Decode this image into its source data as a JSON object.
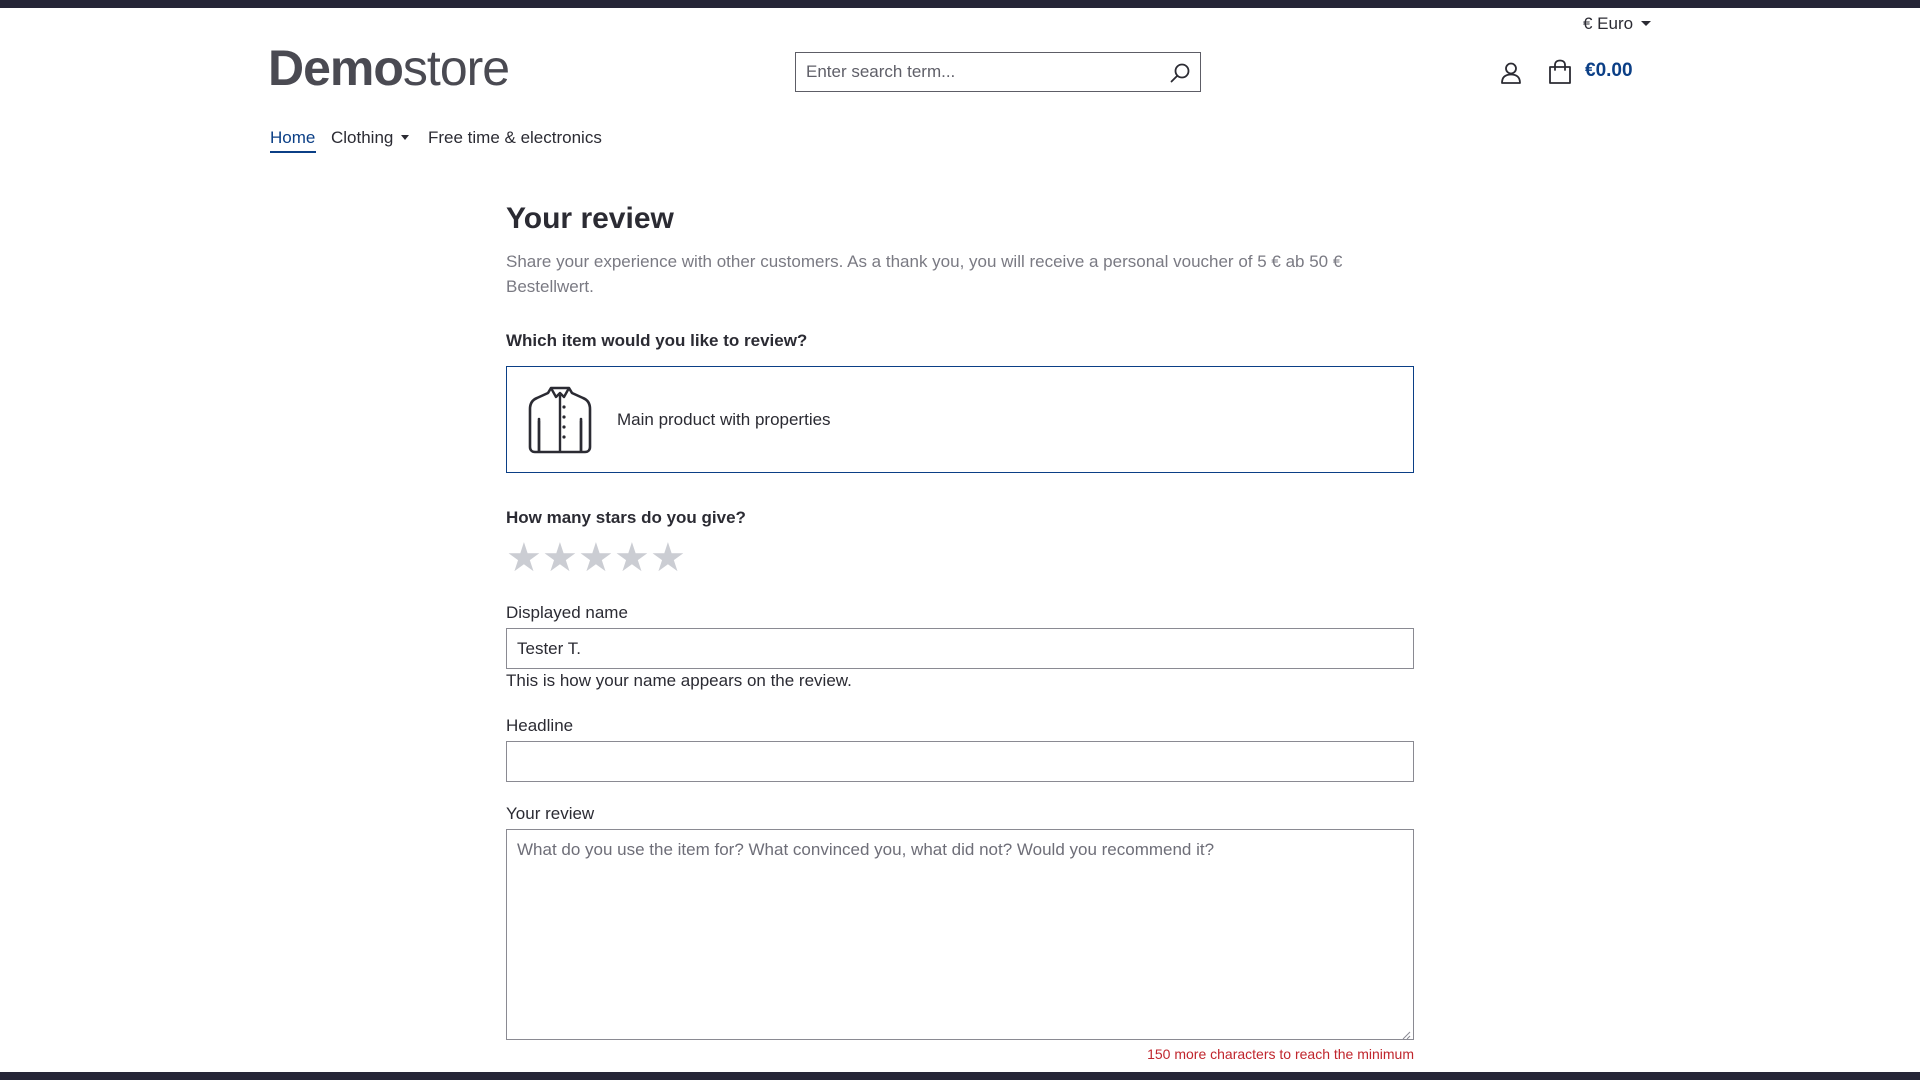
{
  "header": {
    "currency": "€ Euro",
    "logo_bold": "Demo",
    "logo_light": "store",
    "search_placeholder": "Enter search term...",
    "cart_total": "€0.00"
  },
  "nav": {
    "items": [
      {
        "label": "Home",
        "active": true
      },
      {
        "label": "Clothing",
        "has_dropdown": true
      },
      {
        "label": "Free time & electronics"
      }
    ]
  },
  "review": {
    "title": "Your review",
    "intro": "Share your experience with other customers. As a thank you, you will receive a personal voucher of 5 € ab 50 € Bestellwert.",
    "item_question": "Which item would you like to review?",
    "product_name": "Main product with properties",
    "stars_question": "How many stars do you give?",
    "stars": {
      "max": 5,
      "selected": 0
    },
    "displayed_name_label": "Displayed name",
    "displayed_name_value": "Tester T.",
    "displayed_name_help": "This is how your name appears on the review.",
    "headline_label": "Headline",
    "headline_value": "",
    "review_label": "Your review",
    "review_placeholder": "What do you use the item for? What convinced you, what did not? Would you recommend it?",
    "counter_text": "150 more characters to reach the minimum"
  },
  "colors": {
    "accent": "#0b3f86",
    "star_empty": "#cbcdd3",
    "error": "#c0262d",
    "frame": "#262637"
  },
  "icons": {
    "search": "search-icon",
    "account": "user-icon",
    "cart": "shopping-bag-icon",
    "product": "jacket-icon",
    "star": "star-icon"
  }
}
